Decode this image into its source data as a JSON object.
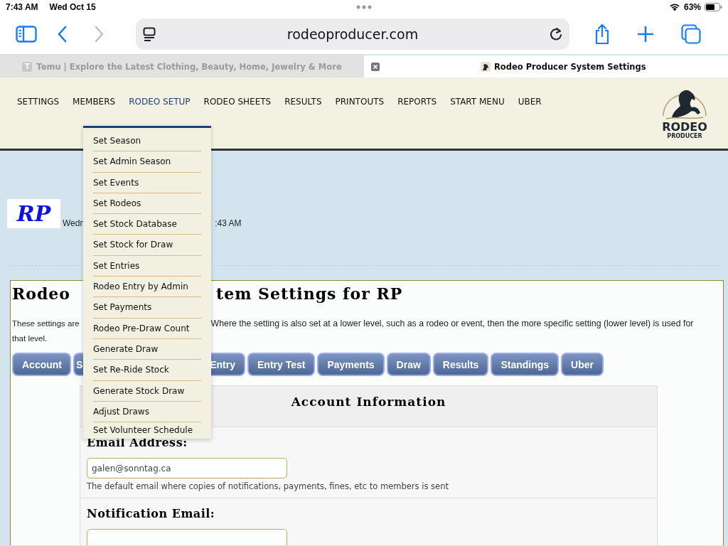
{
  "status_bar": {
    "time": "7:43 AM",
    "date": "Wed Oct 15",
    "battery": "63%"
  },
  "browser": {
    "address": "rodeoproducer.com",
    "tabs": [
      {
        "title": "Temu | Explore the Latest Clothing, Beauty, Home, Jewelry & More",
        "favicon": "T",
        "selected": false
      },
      {
        "title": "Rodeo Producer System Settings",
        "selected": true
      }
    ]
  },
  "site_nav": {
    "items": [
      {
        "label": "SETTINGS",
        "selected": false
      },
      {
        "label": "MEMBERS",
        "selected": false
      },
      {
        "label": "RODEO SETUP",
        "selected": true
      },
      {
        "label": "RODEO SHEETS",
        "selected": false
      },
      {
        "label": "RESULTS",
        "selected": false
      },
      {
        "label": "PRINTOUTS",
        "selected": false
      },
      {
        "label": "REPORTS",
        "selected": false
      },
      {
        "label": "START MENU",
        "selected": false
      },
      {
        "label": "UBER",
        "selected": false
      }
    ],
    "logo": {
      "title": "RODEO",
      "subtitle": "PRODUCER"
    }
  },
  "dropdown": {
    "items": [
      "Set Season",
      "Set Admin Season",
      "Set Events",
      "Set Rodeos",
      "Set Stock Database",
      "Set Stock for Draw",
      "Set Entries",
      "Rodeo Entry by Admin",
      "Set Payments",
      "Rodeo Pre-Draw Count",
      "Generate Draw",
      "Set Re-Ride Stock",
      "Generate Stock Draw",
      "Adjust Draws",
      "Set Volunteer Schedule"
    ]
  },
  "org": {
    "logo": "RP",
    "date_start": "Wedn",
    "date_end": ":43 AM"
  },
  "panel": {
    "title_start": "Rodeo",
    "title_end": "tem Settings for RP",
    "description_start": "These settings are",
    "description_end": "Where the setting is also set at a lower level, such as a rodeo or event, then the more specific setting (lower level) is used for",
    "description_next": "that level.",
    "tabs": [
      {
        "label": "Account"
      },
      {
        "label": "S"
      },
      {
        "label": "Entry"
      },
      {
        "label": "Entry Test"
      },
      {
        "label": "Payments"
      },
      {
        "label": "Draw"
      },
      {
        "label": "Results"
      },
      {
        "label": "Standings"
      },
      {
        "label": "Uber"
      }
    ],
    "section": {
      "title": "Account Information",
      "fields": [
        {
          "label": "Email Address:",
          "value": "galen@sonntag.ca",
          "help": "The default email where copies of notifications, payments, fines, etc to members is sent"
        },
        {
          "label": "Notification Email:"
        }
      ]
    }
  }
}
